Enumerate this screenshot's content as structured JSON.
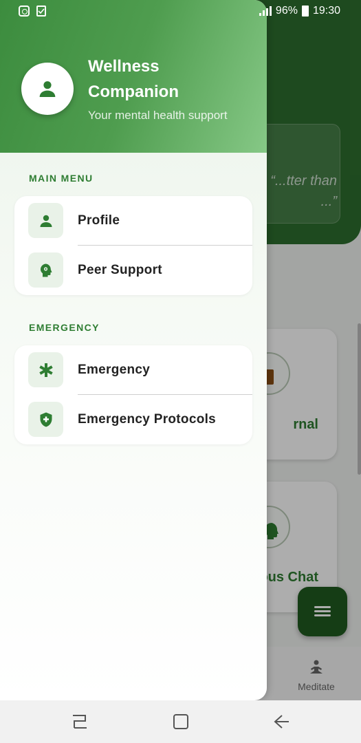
{
  "status_bar": {
    "battery": "96%",
    "time": "19:30"
  },
  "background": {
    "quote": "“...tter than\n...”",
    "card_journal": "rnal",
    "card_chat": "ous Chat",
    "bottom_nav_meditate": "Meditate",
    "colors": {
      "header": "#2d6e2e",
      "accent": "#2e7d32"
    }
  },
  "drawer": {
    "app_title": "Wellness Companion",
    "app_subtitle": "Your mental health support",
    "sections": [
      {
        "title": "MAIN MENU",
        "items": [
          {
            "label": "Profile",
            "icon": "person-icon"
          },
          {
            "label": "Peer Support",
            "icon": "head-gear-icon"
          }
        ]
      },
      {
        "title": "EMERGENCY",
        "items": [
          {
            "label": "Emergency",
            "icon": "asterisk-icon"
          },
          {
            "label": "Emergency Protocols",
            "icon": "shield-plus-icon"
          }
        ]
      }
    ],
    "colors": {
      "header_start": "#3c8c3e",
      "header_end": "#86c886",
      "icon_bg": "#e9f2e8",
      "icon_fg": "#2e7d32"
    }
  },
  "nav_bar": {
    "buttons": [
      "recents-icon",
      "home-icon",
      "back-icon"
    ]
  }
}
